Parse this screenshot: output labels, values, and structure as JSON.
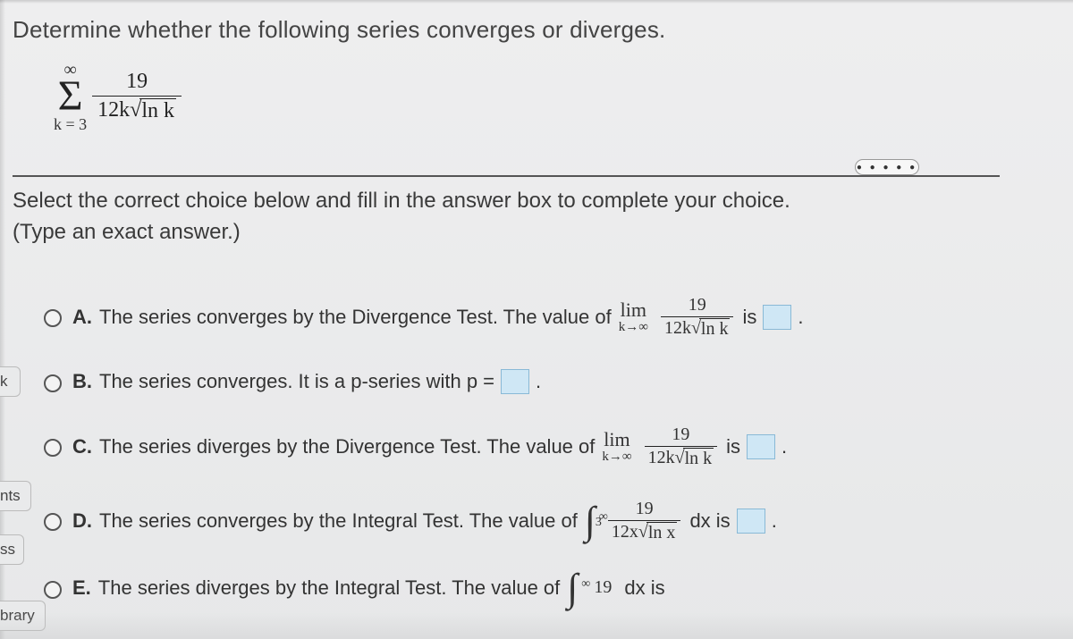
{
  "question": {
    "prompt": "Determine whether the following series converges or diverges."
  },
  "series": {
    "upper": "∞",
    "lower": "k = 3",
    "numerator": "19",
    "den_pref": "12k",
    "den_sqrt": "ln k"
  },
  "instructions": {
    "line1": "Select the correct choice below and fill in the answer box to complete your choice.",
    "line2": "(Type an exact answer.)"
  },
  "math": {
    "lim": "lim",
    "lim_sub_k": "k→∞",
    "frac_k": {
      "num": "19",
      "den_pref": "12k",
      "den_sqrt": "ln k"
    },
    "frac_x": {
      "num": "19",
      "den_pref": "12x",
      "den_sqrt": "ln x"
    },
    "int": {
      "upper": "∞",
      "lower": "3"
    }
  },
  "choices": [
    {
      "label": "A.",
      "text_pre": "The series converges by the Divergence Test. The value of ",
      "text_post": " is "
    },
    {
      "label": "B.",
      "text_pre": "The series converges. It is a p-series with p = "
    },
    {
      "label": "C.",
      "text_pre": "The series diverges by the Divergence Test. The value of ",
      "text_post": " is "
    },
    {
      "label": "D.",
      "text_pre": "The series converges by the Integral Test. The value of ",
      "text_post": " dx is "
    },
    {
      "label": "E.",
      "text_pre": "The series diverges by the Integral Test. The value of ",
      "text_post": " dx is"
    }
  ],
  "side_tabs": [
    "k",
    "nts",
    "ss",
    "brary"
  ]
}
